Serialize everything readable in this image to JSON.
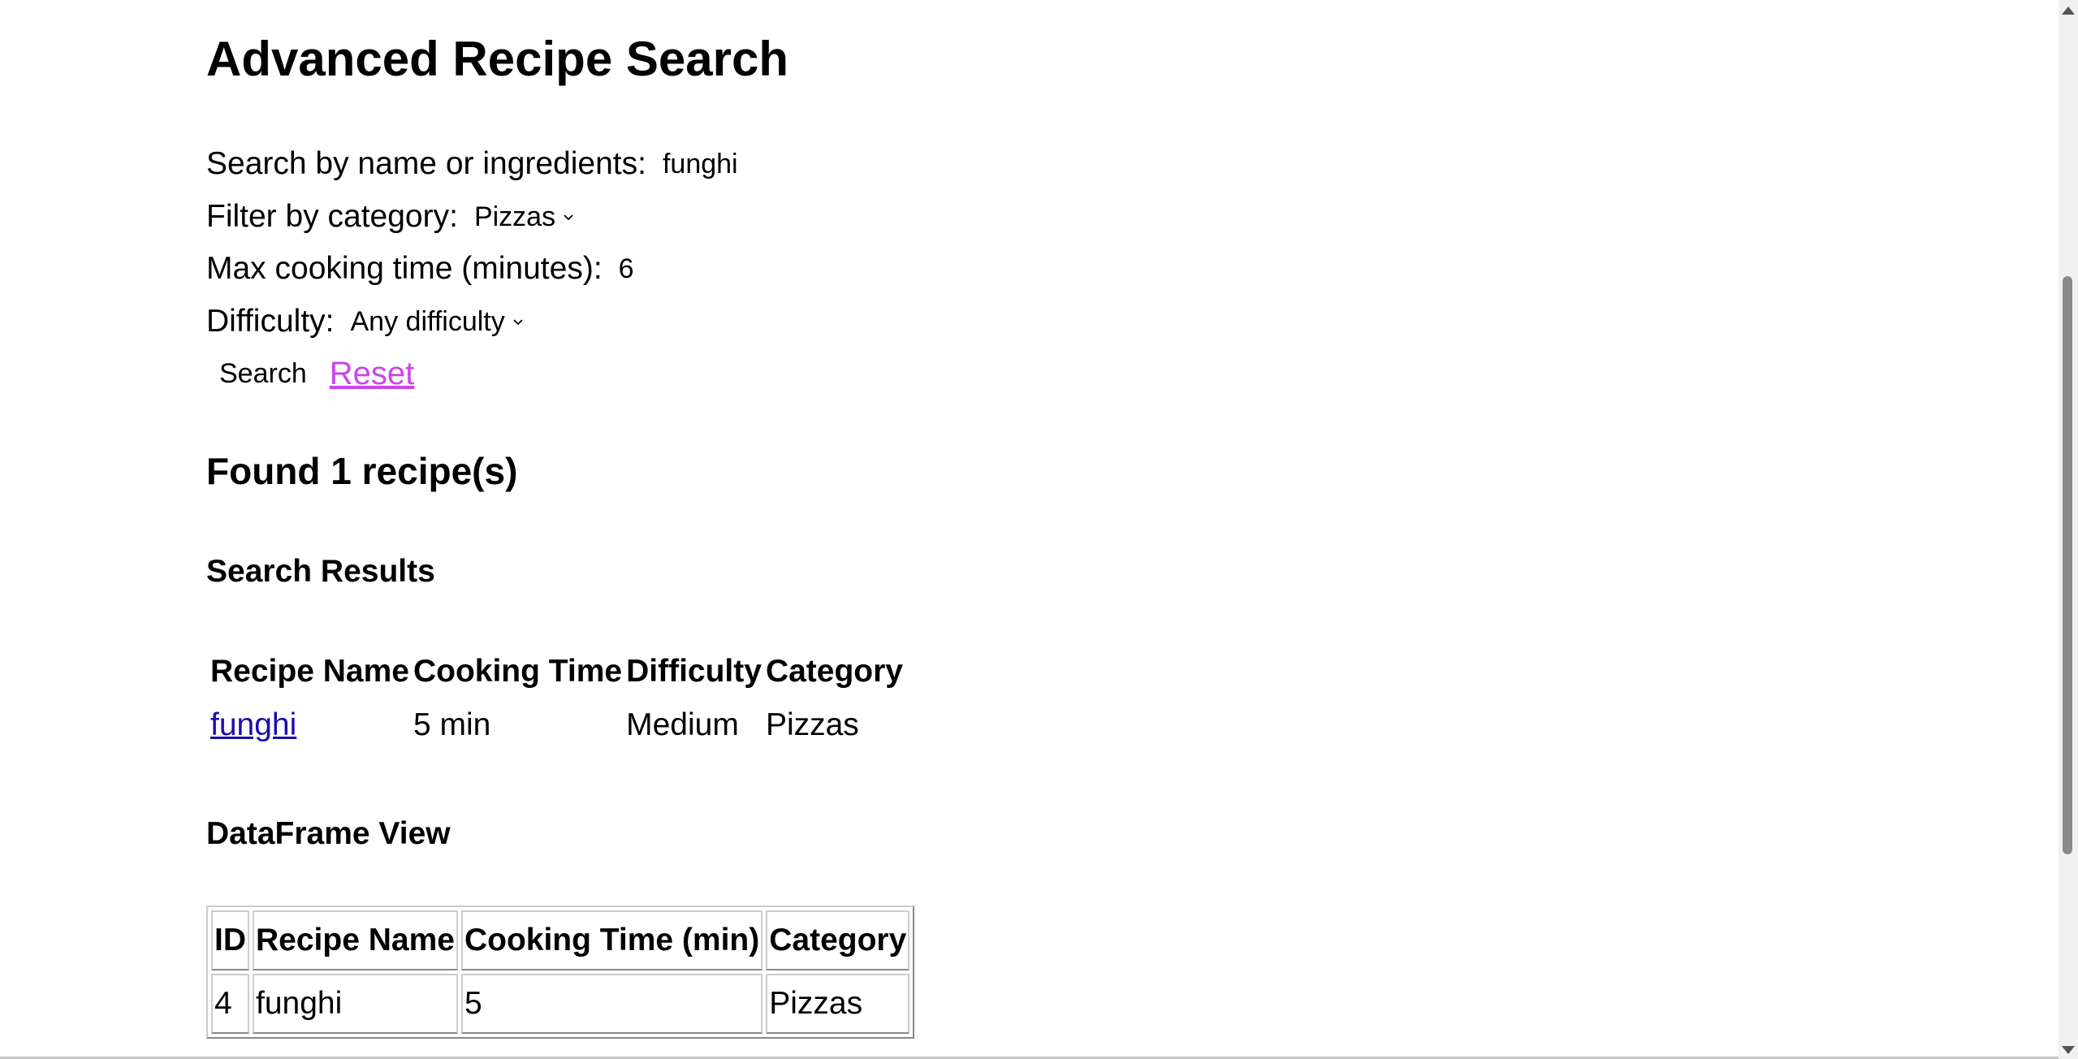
{
  "page": {
    "title": "Advanced Recipe Search"
  },
  "form": {
    "search_label": "Search by name or ingredients:",
    "search_value": "funghi",
    "category_label": "Filter by category:",
    "category_value": "Pizzas",
    "time_label": "Max cooking time (minutes):",
    "time_value": "6",
    "difficulty_label": "Difficulty:",
    "difficulty_value": "Any difficulty",
    "search_button": "Search",
    "reset_link": "Reset"
  },
  "results": {
    "found_text": "Found 1 recipe(s)",
    "heading": "Search Results",
    "columns": [
      "Recipe Name",
      "Cooking Time",
      "Difficulty",
      "Category"
    ],
    "rows": [
      {
        "name": "funghi",
        "time": "5 min",
        "difficulty": "Medium",
        "category": "Pizzas"
      }
    ]
  },
  "dataframe": {
    "heading": "DataFrame View",
    "columns": [
      "ID",
      "Recipe Name",
      "Cooking Time (min)",
      "Category"
    ],
    "rows": [
      {
        "id": "4",
        "name": "funghi",
        "time": "5",
        "category": "Pizzas"
      }
    ]
  },
  "colors": {
    "link": "#1a0dab",
    "reset_link": "#cc44ee"
  },
  "icons": {
    "dropdown": "chevron-down-icon"
  }
}
